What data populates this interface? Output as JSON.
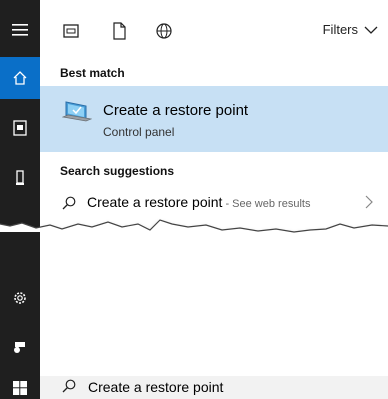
{
  "sidebar": {
    "items": [
      {
        "icon": "hamburger-menu-icon"
      },
      {
        "icon": "home-icon",
        "active": true
      },
      {
        "icon": "document-icon"
      },
      {
        "icon": "device-icon"
      },
      {
        "icon": "settings-gear-icon"
      },
      {
        "icon": "user-feedback-icon"
      },
      {
        "icon": "windows-start-icon"
      }
    ],
    "active_color": "#0a6fc8",
    "background_color": "#1f1f1f"
  },
  "top_bar": {
    "icons": [
      "apps-icon",
      "documents-icon",
      "web-globe-icon"
    ],
    "filters_label": "Filters"
  },
  "best_match": {
    "section_title": "Best match",
    "title": "Create a restore point",
    "subtitle": "Control panel",
    "icon": "restore-point-laptop-icon",
    "highlight_color": "#c7e0f4"
  },
  "suggestions": {
    "section_title": "Search suggestions",
    "items": [
      {
        "text": "Create a restore point",
        "suffix": " - See web results",
        "icon": "search-icon"
      }
    ]
  },
  "search_box": {
    "query": "Create a restore point",
    "icon": "search-icon"
  }
}
